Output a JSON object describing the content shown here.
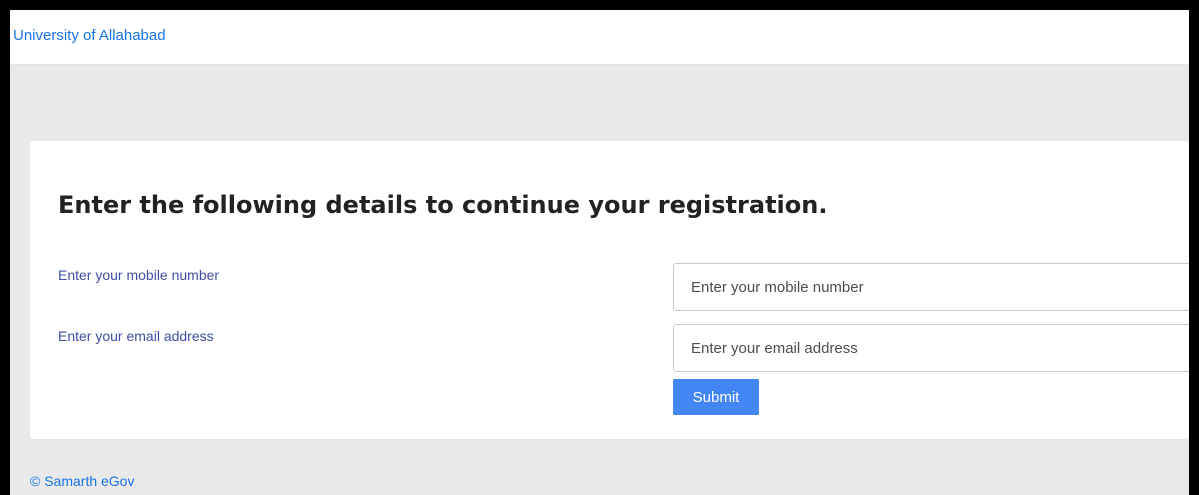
{
  "navbar": {
    "brand": "University of Allahabad"
  },
  "form": {
    "heading": "Enter the following details to continue your registration.",
    "mobile": {
      "label": "Enter your mobile number",
      "placeholder": "Enter your mobile number",
      "value": ""
    },
    "email": {
      "label": "Enter your email address",
      "placeholder": "Enter your email address",
      "value": ""
    },
    "submit_label": "Submit"
  },
  "footer": {
    "text": "© Samarth eGov"
  },
  "colors": {
    "link": "#1a73e8",
    "label": "#3e4ea3",
    "button": "#4285f4",
    "page_background": "#e9e9e9"
  }
}
